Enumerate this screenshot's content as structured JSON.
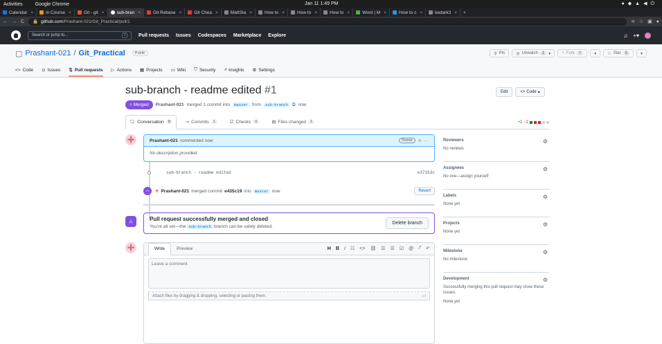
{
  "os": {
    "activities": "Activities",
    "app": "Google Chrome",
    "clock": "Jan 11  1:49 PM"
  },
  "browser": {
    "tabs": [
      {
        "label": "Calendar",
        "color": "#1a73e8"
      },
      {
        "label": "in Course",
        "color": "#f29900"
      },
      {
        "label": "Git - git",
        "color": "#f05133"
      },
      {
        "label": "sub-bran",
        "color": "#ffffff"
      },
      {
        "label": "Git Rebase",
        "color": "#e53935"
      },
      {
        "label": "Git Chea",
        "color": "#e53935"
      },
      {
        "label": "MattSta",
        "color": "#888888"
      },
      {
        "label": "How to",
        "color": "#888888"
      },
      {
        "label": "How to",
        "color": "#888888"
      },
      {
        "label": "How to",
        "color": "#888888"
      },
      {
        "label": "Word | M",
        "color": "#4caf50"
      },
      {
        "label": "How to c",
        "color": "#2196f3"
      },
      {
        "label": "kedark3",
        "color": "#888888"
      }
    ],
    "url_host": "github.com",
    "url_path": "/Prashant-021/Git_Practical/pull/1"
  },
  "gh": {
    "search_placeholder": "Search or jump to...",
    "slash": "/",
    "nav": [
      "Pull requests",
      "Issues",
      "Codespaces",
      "Marketplace",
      "Explore"
    ]
  },
  "repo": {
    "owner": "Prashant-021",
    "sep": " / ",
    "name": "Git_Practical",
    "visibility": "Public",
    "pin": "Pin",
    "unwatch": "Unwatch",
    "watch_count": "1",
    "fork": "Fork",
    "fork_count": "0",
    "star": "Star",
    "star_count": "0",
    "tabs": [
      "Code",
      "Issues",
      "Pull requests",
      "Actions",
      "Projects",
      "Wiki",
      "Security",
      "Insights",
      "Settings"
    ]
  },
  "pr": {
    "title": "sub-branch - readme edited",
    "number": "#1",
    "edit": "Edit",
    "code": "Code",
    "status": "Merged",
    "author": "Prashant-021",
    "meta_text": "merged 1 commit into",
    "base": "master",
    "from": "from",
    "head": "sub-branch",
    "when": "now",
    "tabs": [
      {
        "label": "Conversation",
        "count": "0"
      },
      {
        "label": "Commits",
        "count": "1"
      },
      {
        "label": "Checks",
        "count": "0"
      },
      {
        "label": "Files changed",
        "count": "1"
      }
    ],
    "additions": "+1",
    "deletions": "−2"
  },
  "comment": {
    "author": "Prashant-021",
    "action": "commented now",
    "role": "Owner",
    "body": "No description provided."
  },
  "commit": {
    "message": "sub-branch - readme edited",
    "sha": "e371b3c"
  },
  "merge_event": {
    "author": "Prashant-021",
    "text": "merged commit",
    "sha": "e435c19",
    "into": "into",
    "branch": "master",
    "when": "now",
    "revert": "Revert"
  },
  "merged_box": {
    "title": "Pull request successfully merged and closed",
    "pre": "You're all set—the",
    "branch": "sub-branch",
    "post": "branch can be safely deleted.",
    "button": "Delete branch"
  },
  "editor": {
    "write": "Write",
    "preview": "Preview",
    "placeholder": "Leave a comment",
    "footer": "Attach files by dragging & dropping, selecting or pasting them."
  },
  "sidebar": [
    {
      "heading": "Reviewers",
      "value": "No reviews"
    },
    {
      "heading": "Assignees",
      "value": "No one—assign yourself"
    },
    {
      "heading": "Labels",
      "value": "None yet"
    },
    {
      "heading": "Projects",
      "value": "None yet"
    },
    {
      "heading": "Milestone",
      "value": "No milestone"
    },
    {
      "heading": "Development",
      "value": "Successfully merging this pull request may close these issues.",
      "value2": "None yet"
    }
  ]
}
